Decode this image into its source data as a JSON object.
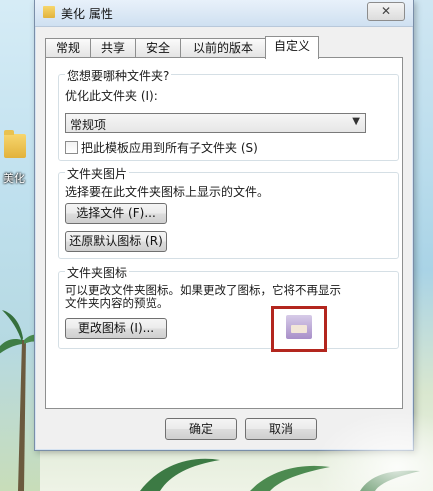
{
  "desktop": {
    "folder_label": "美化"
  },
  "window": {
    "title": "美化 属性",
    "close_symbol": "✕",
    "tabs": [
      {
        "label": "常规"
      },
      {
        "label": "共享"
      },
      {
        "label": "安全"
      },
      {
        "label": "以前的版本"
      },
      {
        "label": "自定义"
      }
    ],
    "active_tab": "自定义"
  },
  "group_folder_type": {
    "legend": "您想要哪种文件夹?",
    "optimize_label": "优化此文件夹 (I):",
    "optimize_value": "常规项",
    "apply_subfolders_label": "把此模板应用到所有子文件夹 (S)",
    "apply_subfolders_checked": false
  },
  "group_folder_picture": {
    "legend": "文件夹图片",
    "description": "选择要在此文件夹图标上显示的文件。",
    "choose_file_button": "选择文件 (F)...",
    "restore_default_button": "还原默认图标 (R)"
  },
  "group_folder_icon": {
    "legend": "文件夹图标",
    "description_line1": "可以更改文件夹图标。如果更改了图标，它将不再显示",
    "description_line2": "文件夹内容的预览。",
    "change_icon_button": "更改图标 (I)..."
  },
  "footer": {
    "ok_button": "确定",
    "cancel_button": "取消"
  },
  "colors": {
    "highlight_border": "#b3261e",
    "window_bg": "#f0f0f0"
  }
}
